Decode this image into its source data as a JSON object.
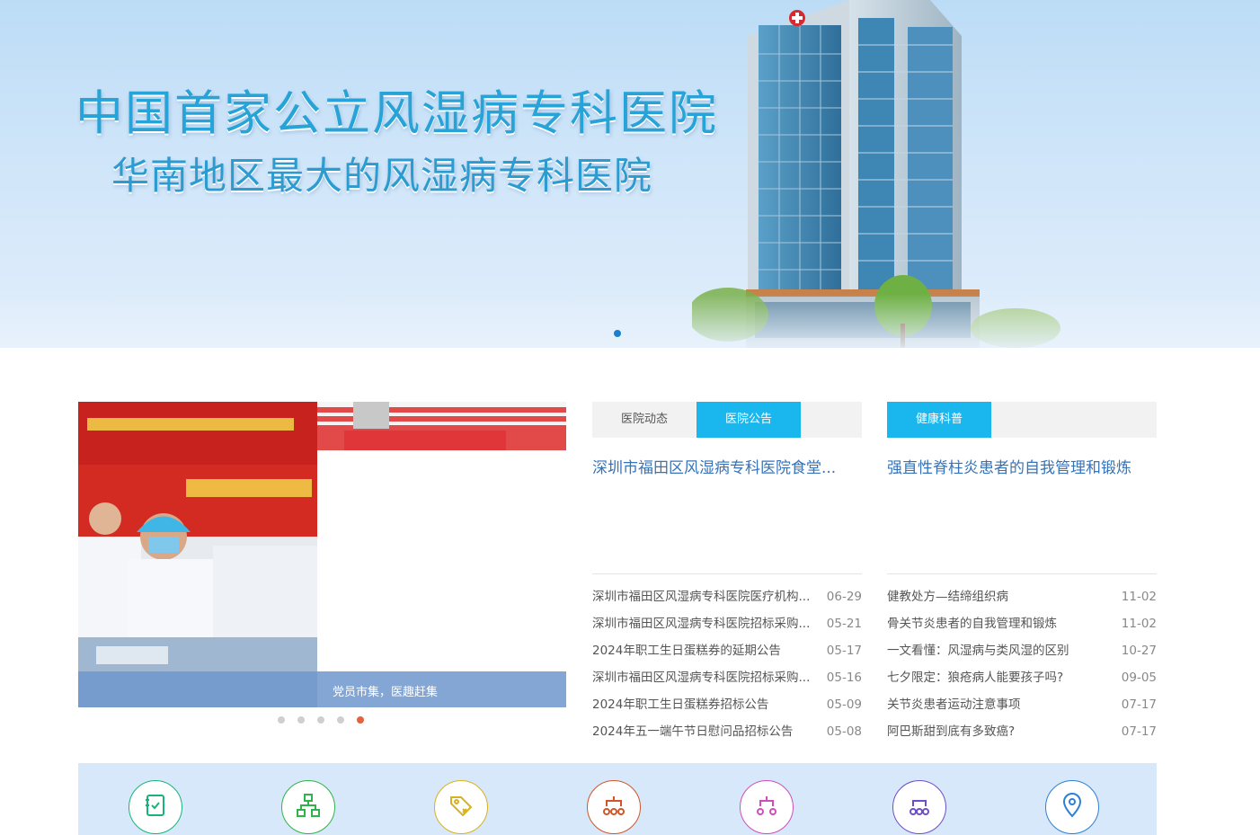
{
  "banner": {
    "line1": "中国首家公立风湿病专科医院",
    "line2": "华南地区最大的风湿病专科医院"
  },
  "slider": {
    "caption": "党员市集，医趣赶集",
    "dots": 5,
    "active_dot": 5
  },
  "hospital_news": {
    "tabs": [
      {
        "label": "医院动态",
        "active": false
      },
      {
        "label": "医院公告",
        "active": true
      }
    ],
    "headline": "深圳市福田区风湿病专科医院食堂...",
    "items": [
      {
        "title": "深圳市福田区风湿病专科医院医疗机构...",
        "date": "06-29"
      },
      {
        "title": "深圳市福田区风湿病专科医院招标采购...",
        "date": "05-21"
      },
      {
        "title": "2024年职工生日蛋糕券的延期公告",
        "date": "05-17"
      },
      {
        "title": "深圳市福田区风湿病专科医院招标采购...",
        "date": "05-16"
      },
      {
        "title": "2024年职工生日蛋糕券招标公告",
        "date": "05-09"
      },
      {
        "title": "2024年五一端午节日慰问品招标公告",
        "date": "05-08"
      }
    ]
  },
  "health_science": {
    "tabs": [
      {
        "label": "健康科普",
        "active": true
      }
    ],
    "headline": "强直性脊柱炎患者的自我管理和锻炼",
    "items": [
      {
        "title": "健教处方—结缔组织病",
        "date": "11-02"
      },
      {
        "title": "骨关节炎患者的自我管理和锻炼",
        "date": "11-02"
      },
      {
        "title": "一文看懂：风湿病与类风湿的区别",
        "date": "10-27"
      },
      {
        "title": "七夕限定：狼疮病人能要孩子吗?",
        "date": "09-05"
      },
      {
        "title": "关节炎患者运动注意事项",
        "date": "07-17"
      },
      {
        "title": "阿巴斯甜到底有多致癌?",
        "date": "07-17"
      }
    ]
  },
  "services": [
    {
      "icon": "appointment-book-icon",
      "color": "#19b37a"
    },
    {
      "icon": "department-tree-icon",
      "color": "#2fb34a"
    },
    {
      "icon": "price-tag-icon",
      "color": "#d8b21c"
    },
    {
      "icon": "expert-team-icon",
      "color": "#d0562a"
    },
    {
      "icon": "doctor-team-icon",
      "color": "#cf4fb8"
    },
    {
      "icon": "medical-staff-icon",
      "color": "#6d4fc7"
    },
    {
      "icon": "location-pin-icon",
      "color": "#2e7fd6"
    }
  ],
  "colors": {
    "accent": "#1ab7ef",
    "headline": "#3773b8",
    "banner_text": "#27a3d8",
    "active_dot": "#e2643a"
  }
}
